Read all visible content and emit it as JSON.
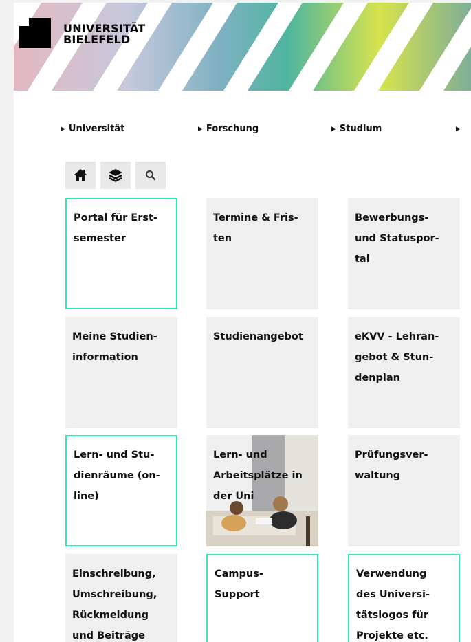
{
  "header": {
    "logo_line1": "UNIVERSITÄT",
    "logo_line2": "BIELEFELD",
    "stripe_colors": [
      "#e3b8c0",
      "#c6c8dc",
      "#8fb6c4",
      "#5fb3a4",
      "#56c2a0",
      "#d7e34c",
      "#c8d96a",
      "#8bbf9a"
    ]
  },
  "nav": {
    "items": [
      {
        "label": "Universität"
      },
      {
        "label": "Forschung"
      },
      {
        "label": "Studium"
      },
      {
        "label": ""
      }
    ]
  },
  "toolbar": {
    "buttons": [
      {
        "icon": "home-icon"
      },
      {
        "icon": "layers-icon"
      },
      {
        "icon": "search-icon"
      }
    ]
  },
  "tiles": [
    {
      "lines": [
        "Portal für Erst-",
        "semester"
      ],
      "outlined": true
    },
    {
      "lines": [
        "Termine & Fris-",
        "ten"
      ],
      "outlined": false
    },
    {
      "lines": [
        "Bewerbungs-",
        "und Statuspor-",
        "tal"
      ],
      "outlined": false
    },
    {
      "lines": [
        "Meine Studien-",
        "information"
      ],
      "outlined": false
    },
    {
      "lines": [
        "Studienangebot"
      ],
      "outlined": false
    },
    {
      "lines": [
        "eKVV - Lehran-",
        "gebot & Stun-",
        "denplan"
      ],
      "outlined": false
    },
    {
      "lines": [
        "Lern- und Stu-",
        "dienräume (on-",
        "line)"
      ],
      "outlined": true
    },
    {
      "lines": [
        "Lern- und",
        "Arbeitsplätze in",
        "der Uni"
      ],
      "outlined": false,
      "has_image": true
    },
    {
      "lines": [
        "Prüfungsver-",
        "waltung"
      ],
      "outlined": false
    },
    {
      "lines": [
        "Einschreibung,",
        "Umschreibung,",
        "Rückmeldung",
        "und Beiträge"
      ],
      "outlined": false
    },
    {
      "lines": [
        "Campus-",
        "Support"
      ],
      "outlined": true
    },
    {
      "lines": [
        "Verwendung",
        "des Universi-",
        "tätslogos für",
        "Projekte etc."
      ],
      "outlined": true
    }
  ],
  "colors": {
    "accent": "#2ee8b6",
    "tile_bg": "#efefef"
  }
}
